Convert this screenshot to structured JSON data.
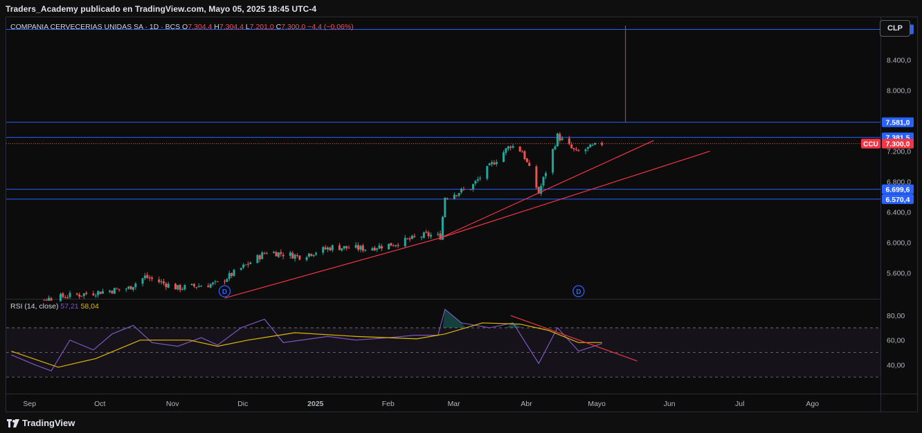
{
  "header": {
    "publisher_line": "Traders_Academy publicado en TradingView.com, Mayo 05, 2025 18:45 UTC-4"
  },
  "legend": {
    "symbol": "COMPANIA CERVECERIAS UNIDAS SA · 1D · BCS",
    "o_label": "O",
    "o_value": "7.304,4",
    "h_label": "H",
    "h_value": "7.304,4",
    "l_label": "L",
    "l_value": "7.201,0",
    "c_label": "C",
    "c_value": "7.300,0",
    "change": "−4,4 (−0,06%)"
  },
  "currency_button": "CLP",
  "footer": {
    "brand": "TradingView"
  },
  "colors": {
    "up": "#26a69a",
    "down": "#ef5350",
    "level": "#2962ff",
    "trend": "#f23645",
    "rsi": "#7e57c2",
    "rsi_ma": "#e3b800",
    "label_blue": "#2962ff",
    "label_red": "#f23645"
  },
  "chart_data": [
    {
      "type": "candlestick",
      "title": "COMPANIA CERVECERIAS UNIDAS SA · 1D · BCS",
      "y_axis_ticks": [
        "8.400,0",
        "8.000,0",
        "7.200,0",
        "6.800,0",
        "6.400,0",
        "6.000,0",
        "5.600,0"
      ],
      "x_axis_ticks": [
        "Sep",
        "Oct",
        "Nov",
        "Dic",
        "2025",
        "Feb",
        "Mar",
        "Abr",
        "Mayo",
        "Jun",
        "Jul",
        "Ago"
      ],
      "ylim": [
        5.26,
        8.96
      ],
      "last_price_label": "CCU",
      "last_price": "7.300,0",
      "horizontal_levels": [
        {
          "value": 8801.1,
          "label": "8.801,1"
        },
        {
          "value": 7581.0,
          "label": "7.581,0"
        },
        {
          "value": 7381.5,
          "label": "7.381,5"
        },
        {
          "value": 6699.6,
          "label": "6.699,6"
        },
        {
          "value": 6570.4,
          "label": "6.570,4"
        }
      ],
      "dividend_markers": [
        {
          "date": "2024-11-25",
          "label": "D"
        },
        {
          "date": "2025-04-25",
          "label": "D"
        }
      ],
      "ohlc_anchor_points": [
        {
          "date": "2024-08-26",
          "close": 5.2
        },
        {
          "date": "2024-10-15",
          "close": 5.4
        },
        {
          "date": "2024-10-22",
          "close": 5.55
        },
        {
          "date": "2024-11-05",
          "close": 5.4
        },
        {
          "date": "2024-11-22",
          "close": 5.46
        },
        {
          "date": "2024-12-03",
          "close": 5.68
        },
        {
          "date": "2024-12-13",
          "close": 5.88
        },
        {
          "date": "2024-12-27",
          "close": 5.82
        },
        {
          "date": "2025-01-10",
          "close": 5.94
        },
        {
          "date": "2025-01-24",
          "close": 5.92
        },
        {
          "date": "2025-02-05",
          "close": 5.98
        },
        {
          "date": "2025-02-19",
          "close": 6.1
        },
        {
          "date": "2025-02-25",
          "close": 6.08
        },
        {
          "date": "2025-02-27",
          "close": 6.6
        },
        {
          "date": "2025-03-10",
          "close": 6.72
        },
        {
          "date": "2025-03-19",
          "close": 7.03
        },
        {
          "date": "2025-03-27",
          "close": 7.28
        },
        {
          "date": "2025-04-01",
          "close": 7.2
        },
        {
          "date": "2025-04-08",
          "close": 6.65
        },
        {
          "date": "2025-04-16",
          "close": 7.4
        },
        {
          "date": "2025-04-24",
          "close": 7.18
        },
        {
          "date": "2025-05-05",
          "close": 7.3
        }
      ]
    },
    {
      "type": "line",
      "title": "RSI (14, close)",
      "title_text": "RSI (14, close)",
      "value_rsi": "57,21",
      "value_ma": "58,04",
      "y_axis_ticks": [
        "80,00",
        "60,00",
        "40,00"
      ],
      "ylim": [
        16,
        93
      ],
      "bands": {
        "upper": 70,
        "middle": 50,
        "lower": 30
      },
      "series": [
        {
          "name": "RSI",
          "points": [
            [
              "2024-08-26",
              48
            ],
            [
              "2024-09-05",
              40
            ],
            [
              "2024-09-12",
              35
            ],
            [
              "2024-09-20",
              60
            ],
            [
              "2024-09-30",
              52
            ],
            [
              "2024-10-08",
              65
            ],
            [
              "2024-10-17",
              72
            ],
            [
              "2024-10-25",
              58
            ],
            [
              "2024-11-05",
              55
            ],
            [
              "2024-11-15",
              62
            ],
            [
              "2024-11-22",
              56
            ],
            [
              "2024-12-02",
              70
            ],
            [
              "2024-12-12",
              77
            ],
            [
              "2024-12-20",
              58
            ],
            [
              "2025-01-08",
              63
            ],
            [
              "2025-01-20",
              60
            ],
            [
              "2025-02-03",
              62
            ],
            [
              "2025-02-14",
              64
            ],
            [
              "2025-02-24",
              64
            ],
            [
              "2025-02-27",
              85
            ],
            [
              "2025-03-06",
              74
            ],
            [
              "2025-03-18",
              70
            ],
            [
              "2025-03-28",
              74
            ],
            [
              "2025-04-08",
              41
            ],
            [
              "2025-04-16",
              70
            ],
            [
              "2025-04-25",
              51
            ],
            [
              "2025-05-05",
              57.21
            ]
          ]
        },
        {
          "name": "RSI-based MA",
          "points": [
            [
              "2024-08-26",
              51
            ],
            [
              "2024-09-15",
              38
            ],
            [
              "2024-10-01",
              45
            ],
            [
              "2024-10-20",
              60
            ],
            [
              "2024-11-10",
              60
            ],
            [
              "2024-11-22",
              55
            ],
            [
              "2024-12-05",
              60
            ],
            [
              "2024-12-25",
              66
            ],
            [
              "2025-01-20",
              63
            ],
            [
              "2025-02-15",
              61
            ],
            [
              "2025-02-27",
              65
            ],
            [
              "2025-03-15",
              74
            ],
            [
              "2025-03-31",
              73
            ],
            [
              "2025-04-12",
              68
            ],
            [
              "2025-04-25",
              58
            ],
            [
              "2025-05-05",
              58.04
            ]
          ]
        }
      ],
      "trendline": [
        [
          "2025-03-27",
          80
        ],
        [
          "2025-05-20",
          43
        ]
      ]
    }
  ],
  "trendlines_price": [
    {
      "from": [
        "2024-11-25",
        5.27
      ],
      "to": [
        "2025-02-25",
        6.06
      ]
    },
    {
      "from": [
        "2025-02-25",
        6.06
      ],
      "to": [
        "2025-06-20",
        7.2
      ]
    },
    {
      "from": [
        "2025-02-25",
        6.06
      ],
      "to": [
        "2025-05-27",
        7.34
      ]
    }
  ],
  "vertical_marker": {
    "date": "2025-05-15",
    "from": 7.58,
    "to": 8.85
  }
}
